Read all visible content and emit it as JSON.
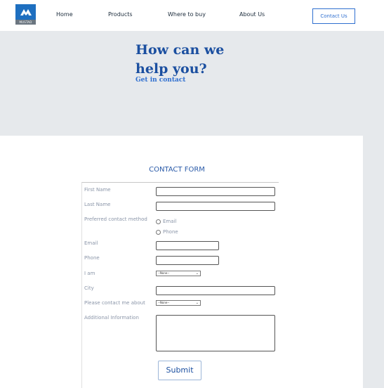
{
  "header": {
    "logo_text": "MUSTAD",
    "nav": [
      "Home",
      "Products",
      "Where to buy",
      "About Us"
    ],
    "contact_button": "Contact Us"
  },
  "hero": {
    "title_line1": "How can we",
    "title_line2": "help you?",
    "subtitle": "Get in contact"
  },
  "form": {
    "heading": "CONTACT FORM",
    "first_name_label": "First Name",
    "last_name_label": "Last Name",
    "preferred_contact_label": "Preferred contact method",
    "radio_email": "Email",
    "radio_phone": "Phone",
    "email_label": "Email",
    "phone_label": "Phone",
    "i_am_label": "I am",
    "i_am_selected": "--None--",
    "city_label": "City",
    "contact_about_label": "Please contact me about",
    "contact_about_selected": "--None--",
    "additional_label": "Additional Information",
    "submit_label": "Submit"
  },
  "colors": {
    "brand_blue": "#1b4fa0",
    "accent_blue": "#2f6fd0",
    "hero_bg": "#e6e9ec"
  }
}
